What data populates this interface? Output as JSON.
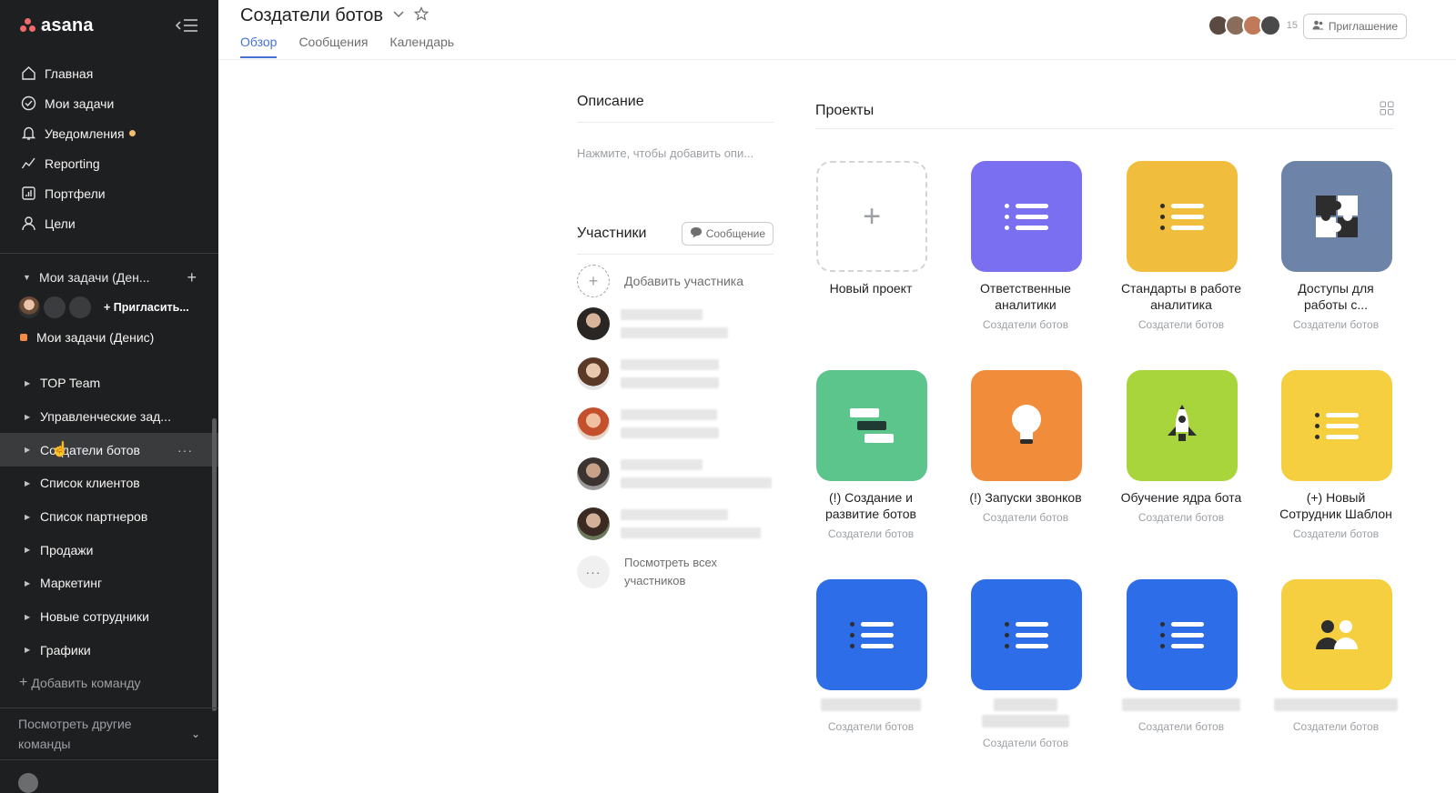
{
  "app": {
    "brand": "asana"
  },
  "nav": {
    "items": [
      {
        "label": "Главная",
        "icon": "home-icon"
      },
      {
        "label": "Мои задачи",
        "icon": "check-circle-icon"
      },
      {
        "label": "Уведомления",
        "icon": "bell-icon"
      },
      {
        "label": "Reporting",
        "icon": "chart-line-icon"
      },
      {
        "label": "Портфели",
        "icon": "portfolio-icon"
      },
      {
        "label": "Цели",
        "icon": "user-goal-icon"
      }
    ]
  },
  "workspace": {
    "mytasks_label": "Мои задачи (Ден...",
    "invite_label": "+ Пригласить...",
    "mytasks_denis": "Мои задачи (Денис)"
  },
  "teams": [
    {
      "label": "TOP Team"
    },
    {
      "label": "Управленческие зад..."
    },
    {
      "label": "Создатели ботов",
      "active": true
    },
    {
      "label": "Список клиентов"
    },
    {
      "label": "Список партнеров"
    },
    {
      "label": "Продажи"
    },
    {
      "label": "Маркетинг"
    },
    {
      "label": "Новые сотрудники"
    },
    {
      "label": "Графики"
    }
  ],
  "sidebar_footer": {
    "add_team": "Добавить команду",
    "other_teams_line1": "Посмотреть другие",
    "other_teams_line2": "команды"
  },
  "header": {
    "title": "Создатели ботов",
    "tabs": [
      "Обзор",
      "Сообщения",
      "Календарь"
    ],
    "member_count": "15",
    "invite_button": "Приглашение"
  },
  "description": {
    "heading": "Описание",
    "placeholder": "Нажмите, чтобы добавить опи..."
  },
  "participants": {
    "heading": "Участники",
    "message_button": "Сообщение",
    "add_label": "Добавить участника",
    "view_all_line1": "Посмотреть всех",
    "view_all_line2": "участников"
  },
  "projects": {
    "heading": "Проекты",
    "team_name": "Создатели ботов",
    "new_project": "Новый проект",
    "items": [
      {
        "line1": "Ответственные",
        "line2": "аналитики",
        "color": "#7a6ff0",
        "icon": "list-icon"
      },
      {
        "line1": "Стандарты в работе",
        "line2": "аналитика",
        "color": "#f1bd3c",
        "icon": "list-icon"
      },
      {
        "line1": "Доступы для",
        "line2": "работы с...",
        "color": "#6d84a8",
        "icon": "puzzle-icon"
      },
      {
        "line1": "(!) Создание и",
        "line2": "развитие ботов",
        "color": "#5cc58c",
        "icon": "timeline-icon"
      },
      {
        "line1": "(!) Запуски звонков",
        "line2": "",
        "color": "#f08c3a",
        "icon": "lightbulb-icon"
      },
      {
        "line1": "Обучение ядра бота",
        "line2": "",
        "color": "#a8d43c",
        "icon": "rocket-icon"
      },
      {
        "line1": "(+) Новый",
        "line2": "Сотрудник Шаблон",
        "color": "#f5cf3f",
        "icon": "list-icon"
      },
      {
        "color": "#2e6de8",
        "icon": "list-icon"
      },
      {
        "color": "#2e6de8",
        "icon": "list-icon"
      },
      {
        "color": "#2e6de8",
        "icon": "list-icon"
      },
      {
        "color": "#f5cf3f",
        "icon": "people-icon"
      }
    ]
  }
}
